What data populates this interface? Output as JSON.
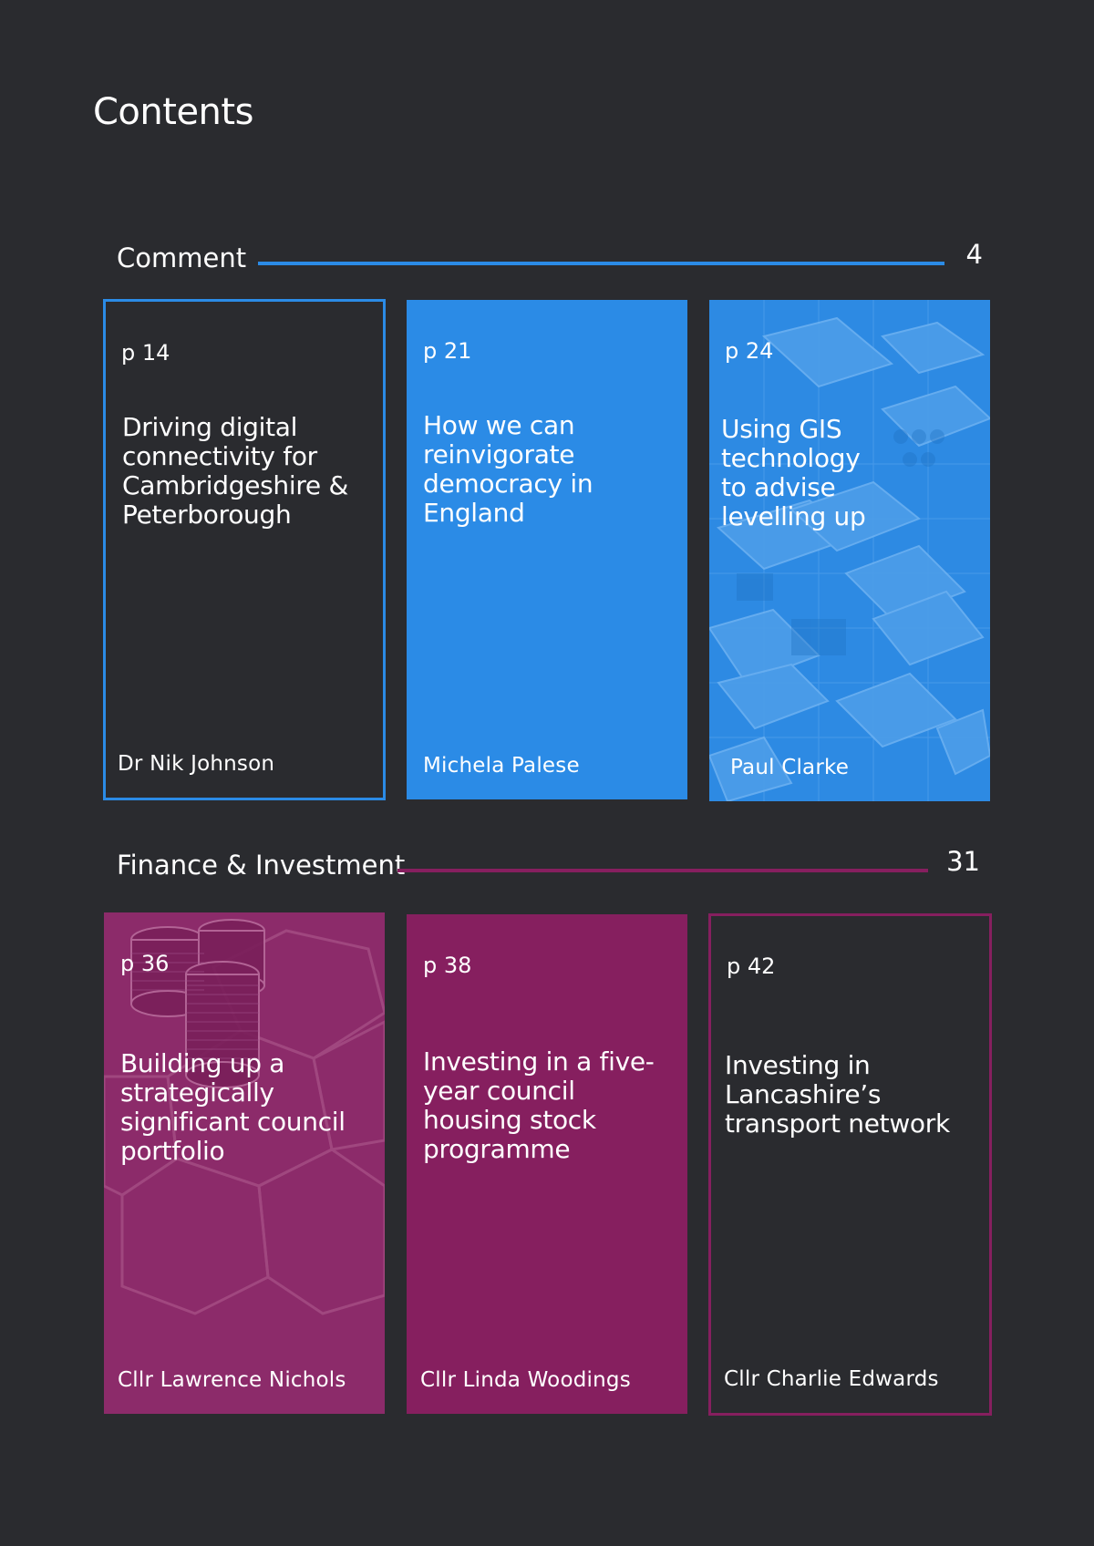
{
  "page": {
    "title": "Contents"
  },
  "sections": [
    {
      "label": "Comment",
      "page": "4",
      "accent": "#2b8be6",
      "cards": [
        {
          "page": "p 14",
          "title": "Driving digital connectivity for Cambridgeshire & Peterborough",
          "author": "Dr Nik Johnson",
          "style": "outline"
        },
        {
          "page": "p 21",
          "title": "How we can reinvigorate democracy in England",
          "author": "Michela Palese",
          "style": "solid"
        },
        {
          "page": "p 24",
          "title": "Using GIS technology to advise levelling up",
          "author": "Paul Clarke",
          "style": "image",
          "image": "city-buildings-overhead-illustration"
        }
      ]
    },
    {
      "label": "Finance & Investment",
      "page": "31",
      "accent": "#861f5f",
      "cards": [
        {
          "page": "p 36",
          "title": "Building up a strategically significant council portfolio",
          "author": "Cllr Lawrence Nichols",
          "style": "image",
          "image": "coin-stacks-illustration"
        },
        {
          "page": "p 38",
          "title": "Investing in a five-year council housing stock programme",
          "author": "Cllr Linda Woodings",
          "style": "solid"
        },
        {
          "page": "p 42",
          "title": "Investing in Lancashire’s transport network",
          "author": "Cllr Charlie Edwards",
          "style": "outline"
        }
      ]
    }
  ],
  "colors": {
    "background": "#2a2b2f",
    "comment_blue": "#2b8be6",
    "finance_magenta": "#861f5f",
    "text": "#ffffff"
  }
}
